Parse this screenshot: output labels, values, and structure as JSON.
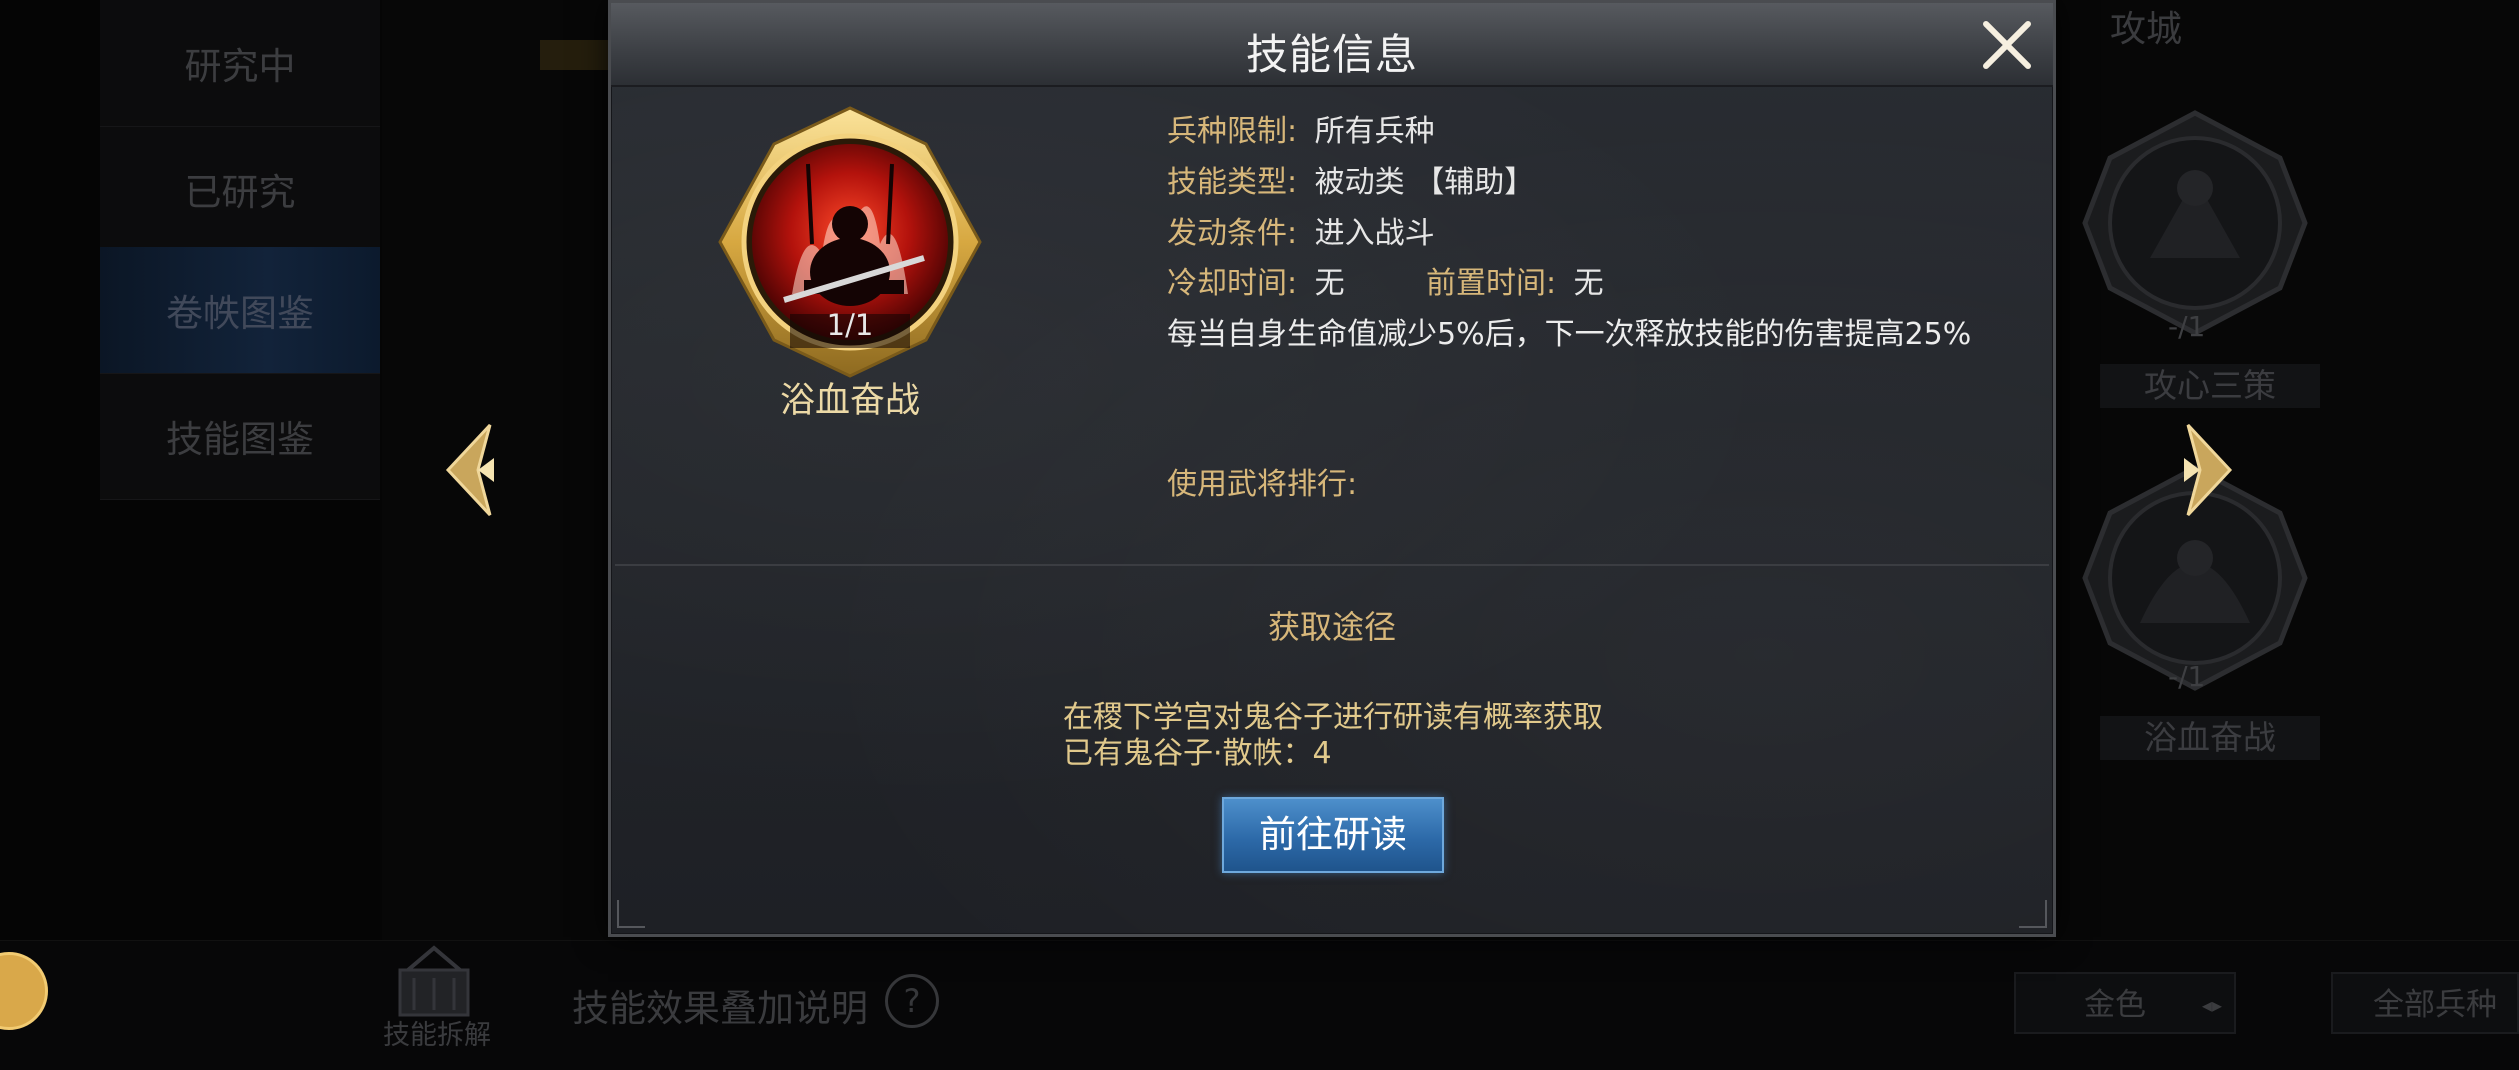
{
  "sidebar": {
    "items": [
      {
        "label": "研究中"
      },
      {
        "label": "已研究"
      },
      {
        "label": "卷帙图鉴"
      },
      {
        "label": "技能图鉴"
      }
    ],
    "active_index": 2
  },
  "background": {
    "siege_label": "攻城",
    "right_skills": [
      {
        "name": "攻心三策",
        "count": "-/1"
      },
      {
        "name": "浴血奋战",
        "count": "-/1"
      }
    ],
    "bottom": {
      "dismantle_label": "技能拆解",
      "stack_text": "技能效果叠加说明",
      "help_symbol": "?",
      "filter_color": "金色",
      "filter_troop": "全部兵种"
    }
  },
  "dialog": {
    "title": "技能信息",
    "skill": {
      "name": "浴血奋战",
      "count": "1/1"
    },
    "info": {
      "troop_label": "兵种限制:",
      "troop_value": "所有兵种",
      "type_label": "技能类型:",
      "type_value": "被动类 【辅助】",
      "trigger_label": "发动条件:",
      "trigger_value": "进入战斗",
      "cooldown_label": "冷却时间:",
      "cooldown_value": "无",
      "precast_label": "前置时间:",
      "precast_value": "无",
      "description": "每当自身生命值减少5%后，下一次释放技能的伤害提高25%",
      "rank_label": "使用武将排行:"
    },
    "acquire": {
      "title": "获取途径",
      "line1": "在稷下学宫对鬼谷子进行研读有概率获取",
      "line2": "已有鬼谷子·散帙：4",
      "button": "前往研读"
    }
  },
  "colors": {
    "accent_gold": "#d7b77a",
    "button_blue": "#2d6aa9"
  }
}
